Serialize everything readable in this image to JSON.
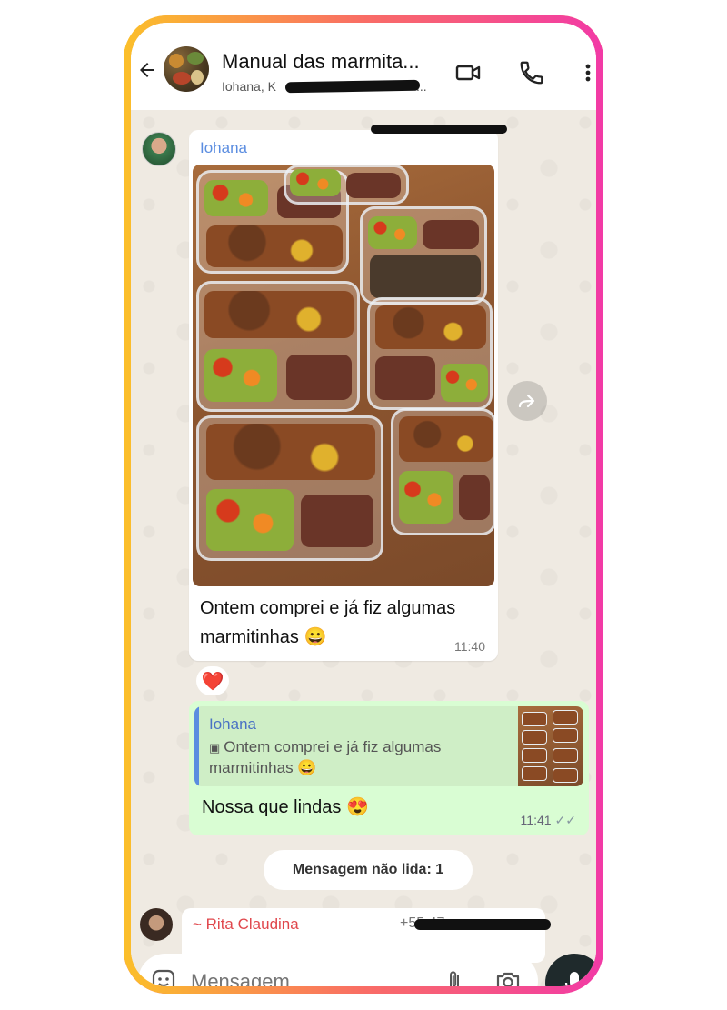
{
  "header": {
    "title": "Manual das marmita...",
    "subtitle": "Iohana, K",
    "subtitle_tail": "...",
    "icons": [
      "back-arrow-icon",
      "video-call-icon",
      "phone-icon",
      "more-vert-icon"
    ]
  },
  "messages": [
    {
      "sender": "Iohana",
      "text": "Ontem comprei e já fiz algumas marmitinhas 😀",
      "time": "11:40",
      "reaction": "❤️"
    }
  ],
  "reply": {
    "quoted_sender": "Iohana",
    "quoted_text": "Ontem comprei e já fiz algumas marmitinhas 😀",
    "text": "Nossa que lindas 😍",
    "time": "11:41"
  },
  "unread_label": "Mensagem não lida: 1",
  "next_message": {
    "sender": "~ Rita Claudina",
    "phone_partial": "+55 47"
  },
  "composer": {
    "placeholder": "Mensagem"
  },
  "colors": {
    "header_bg": "#ffffff",
    "chat_bg": "#efeae2",
    "outgoing_bubble": "#d9fdd3",
    "sender_blue": "#5b8de0",
    "sender_red": "#e0474c",
    "frame_gradient_start": "#fbbf2a",
    "frame_gradient_end": "#f23aa6"
  }
}
